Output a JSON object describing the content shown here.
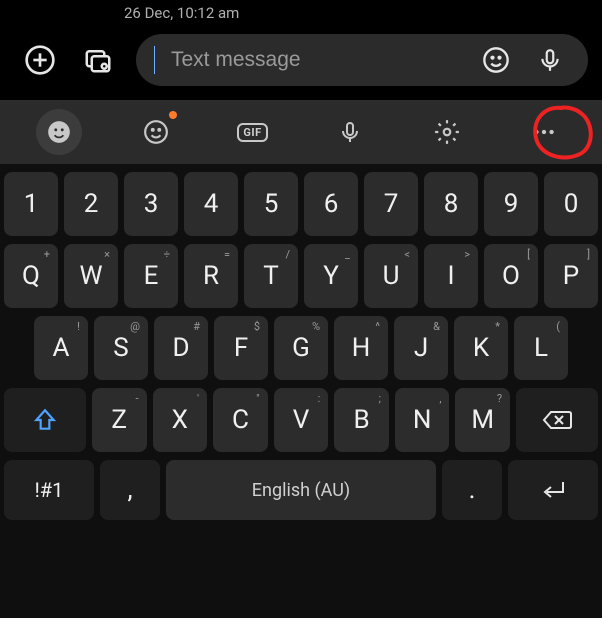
{
  "message": {
    "timestamp": "26 Dec, 10:12 am"
  },
  "compose": {
    "placeholder": "Text message",
    "value": ""
  },
  "toolbar": {
    "items": [
      "emoji-face",
      "sticker",
      "gif",
      "voice",
      "settings",
      "more"
    ],
    "gif_label": "GIF"
  },
  "keyboard": {
    "row_numbers": [
      "1",
      "2",
      "3",
      "4",
      "5",
      "6",
      "7",
      "8",
      "9",
      "0"
    ],
    "row_q": {
      "keys": [
        "Q",
        "W",
        "E",
        "R",
        "T",
        "Y",
        "U",
        "I",
        "O",
        "P"
      ],
      "secondary": [
        "+",
        "×",
        "÷",
        "=",
        "/",
        "_",
        "<",
        ">",
        "[",
        "]"
      ]
    },
    "row_a": {
      "keys": [
        "A",
        "S",
        "D",
        "F",
        "G",
        "H",
        "J",
        "K",
        "L"
      ],
      "secondary": [
        "!",
        "@",
        "#",
        "$",
        "%",
        "^",
        "&",
        "*",
        "("
      ]
    },
    "row_z": {
      "keys": [
        "Z",
        "X",
        "C",
        "V",
        "B",
        "N",
        "M"
      ],
      "secondary": [
        "-",
        "'",
        "\"",
        ":",
        ";",
        ",",
        "?"
      ]
    },
    "bottom": {
      "sym": "!#1",
      "comma": ",",
      "space": "English (AU)",
      "period": "."
    }
  }
}
